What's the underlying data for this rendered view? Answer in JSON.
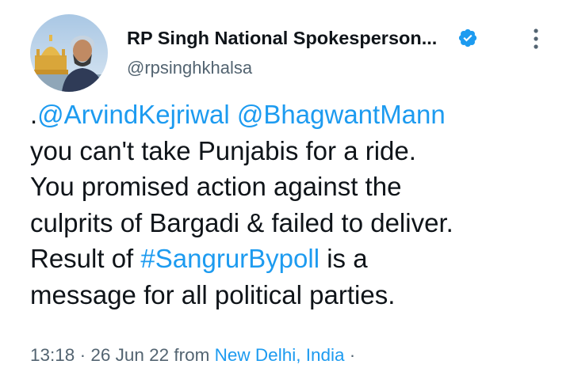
{
  "author": {
    "display_name": "RP Singh National Spokesperson...",
    "handle": "@rpsinghkhalsa",
    "avatar_icon": "profile-photo",
    "verified_icon": "verified-badge-icon",
    "verified_color": "#1d9bf0"
  },
  "menu": {
    "icon": "more-vertical-icon"
  },
  "tweet": {
    "line1": {
      "prefix": ".",
      "mention1": "@ArvindKejriwal",
      "space": " ",
      "mention2": "@BhagwantMann"
    },
    "line2": "you can't take Punjabis for a ride.",
    "line3": "You promised action against the",
    "line4": "culprits of Bargadi & failed to deliver.",
    "line5": {
      "before": "Result of ",
      "hashtag": "#SangrurBypoll",
      "after": " is a"
    },
    "line6": "message for all political parties."
  },
  "meta": {
    "time": "13:18",
    "sep1": " · ",
    "date": "26 Jun 22",
    "from": " from ",
    "location": "New Delhi, India",
    "sep2": " ·"
  },
  "colors": {
    "text": "#0f1419",
    "secondary": "#536471",
    "link": "#1d9bf0"
  }
}
